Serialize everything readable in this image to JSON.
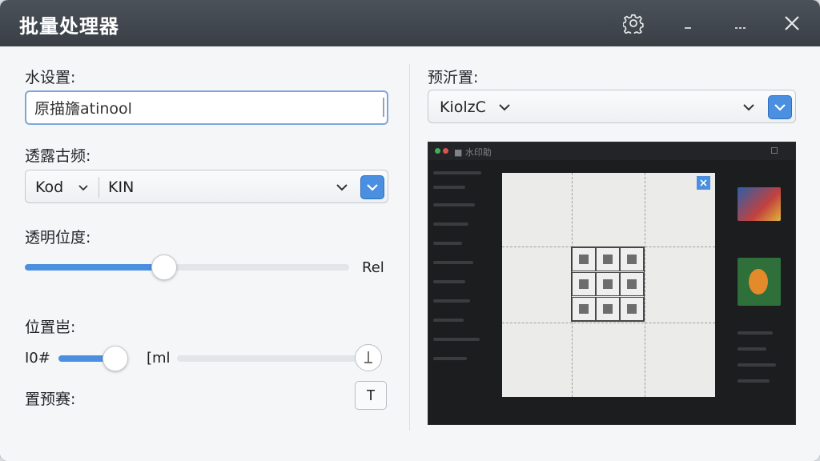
{
  "window": {
    "title": "批量处理器",
    "controls": {
      "settings": "gear-icon",
      "minimize": "minimize-icon",
      "maximize": "maximize-icon",
      "close": "close-icon"
    }
  },
  "left": {
    "watermark_label": "水设置:",
    "watermark_input_value": "原描旝atinool",
    "transparency_label": "透露古频:",
    "format_select": {
      "left_value": "Kod",
      "right_value": "KIN"
    },
    "opacity_label": "透明位度:",
    "opacity_slider": {
      "value_fraction": 0.43,
      "end_text": "Rel"
    },
    "position_label": "位置岜:",
    "position_row": {
      "left_text": "I0#",
      "mid_text": "[ml",
      "slider_a_fraction": 0.85,
      "slider_b_fraction": 1.0
    },
    "preset_label": "置预赛:",
    "preset_button": "T"
  },
  "right": {
    "preset_label": "预沂置:",
    "preset_select_value": "KiolzC",
    "preview": {
      "app_title": "■ 水印助",
      "colors": {
        "accent": "#4a8fe0",
        "canvas": "#ebebea",
        "background": "#1c1d1f"
      }
    }
  }
}
